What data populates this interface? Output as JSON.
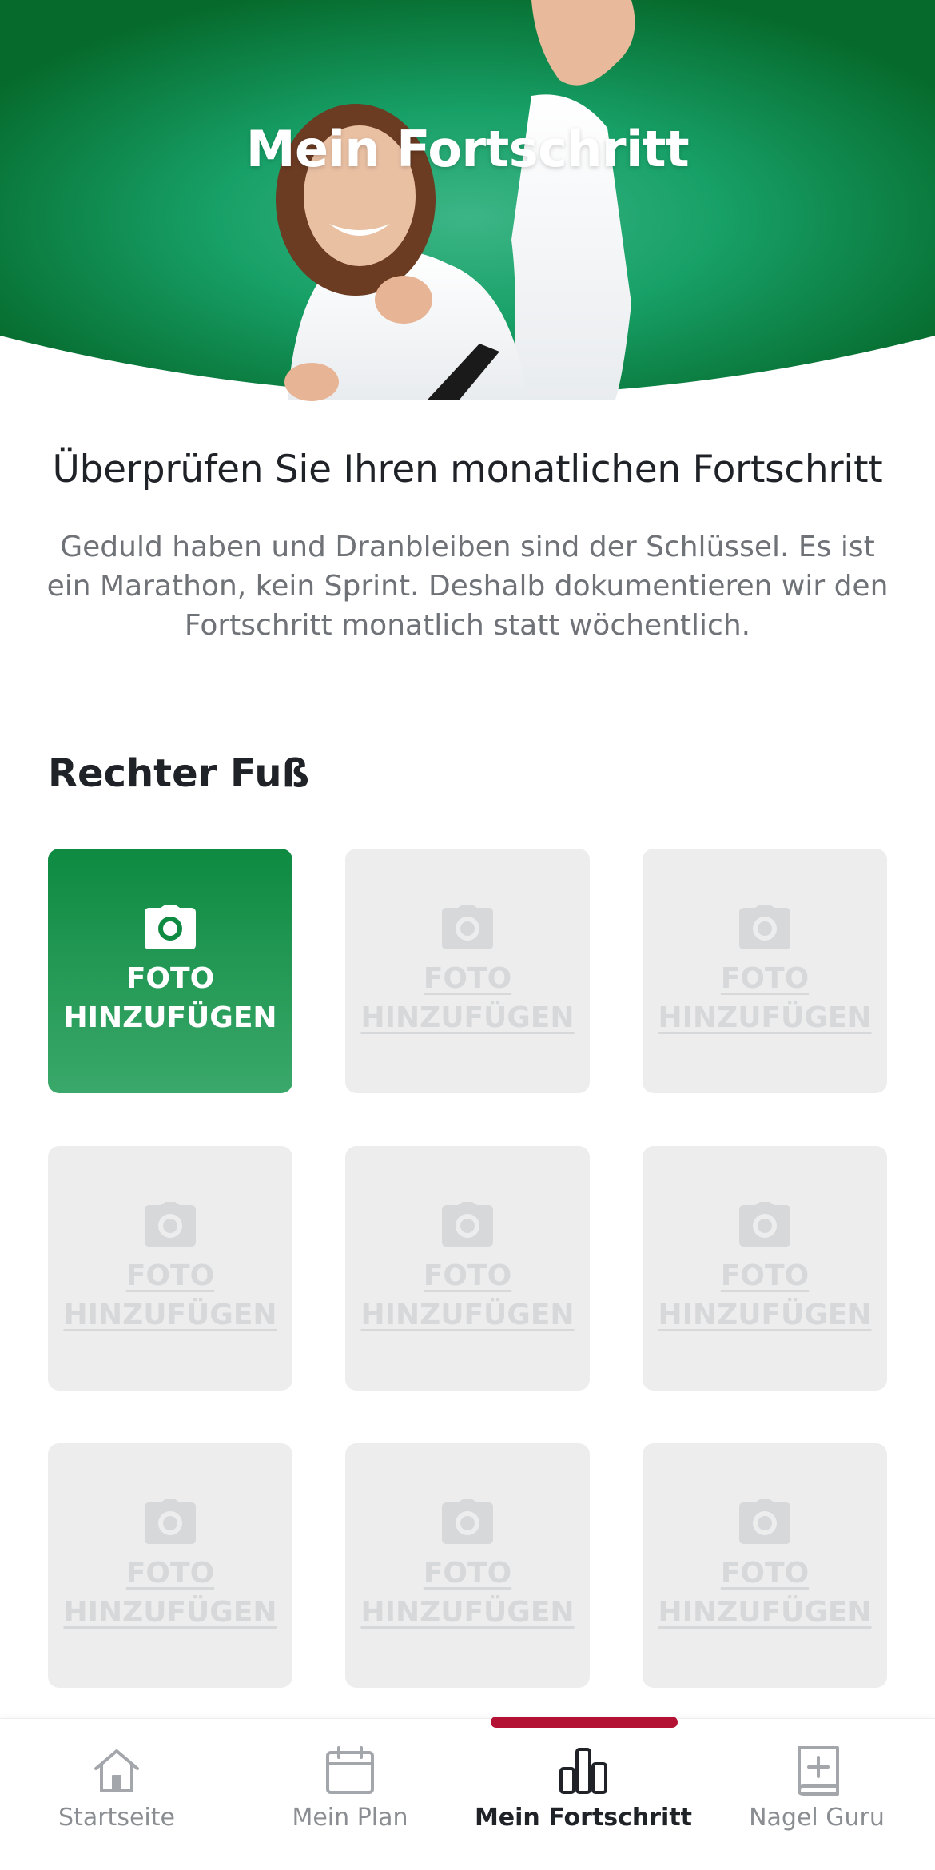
{
  "header": {
    "title": "Mein Fortschritt"
  },
  "intro": {
    "headline": "Überprüfen Sie Ihren monatlichen Fortschritt",
    "text": "Geduld haben und Dranbleiben sind der Schlüssel. Es ist ein Marathon, kein Sprint. Deshalb dokumentieren wir den Fortschritt monatlich statt wöchentlich."
  },
  "section": {
    "title": "Rechter Fuß"
  },
  "tiles": [
    {
      "line1": "FOTO",
      "line2": "HINZUFÜGEN",
      "active": true
    },
    {
      "line1": "FOTO",
      "line2": "HINZUFÜGEN",
      "active": false
    },
    {
      "line1": "FOTO",
      "line2": "HINZUFÜGEN",
      "active": false
    },
    {
      "line1": "FOTO",
      "line2": "HINZUFÜGEN",
      "active": false
    },
    {
      "line1": "FOTO",
      "line2": "HINZUFÜGEN",
      "active": false
    },
    {
      "line1": "FOTO",
      "line2": "HINZUFÜGEN",
      "active": false
    },
    {
      "line1": "FOTO",
      "line2": "HINZUFÜGEN",
      "active": false
    },
    {
      "line1": "FOTO",
      "line2": "HINZUFÜGEN",
      "active": false
    },
    {
      "line1": "FOTO",
      "line2": "HINZUFÜGEN",
      "active": false
    }
  ],
  "nav": {
    "items": [
      {
        "label": "Startseite",
        "icon": "home-icon"
      },
      {
        "label": "Mein Plan",
        "icon": "calendar-icon"
      },
      {
        "label": "Mein Fortschritt",
        "icon": "bar-chart-icon"
      },
      {
        "label": "Nagel Guru",
        "icon": "book-plus-icon"
      }
    ],
    "active_index": 2
  },
  "colors": {
    "brand_green": "#0e8a41",
    "accent_red": "#b31235",
    "tile_inactive": "#ededee"
  }
}
